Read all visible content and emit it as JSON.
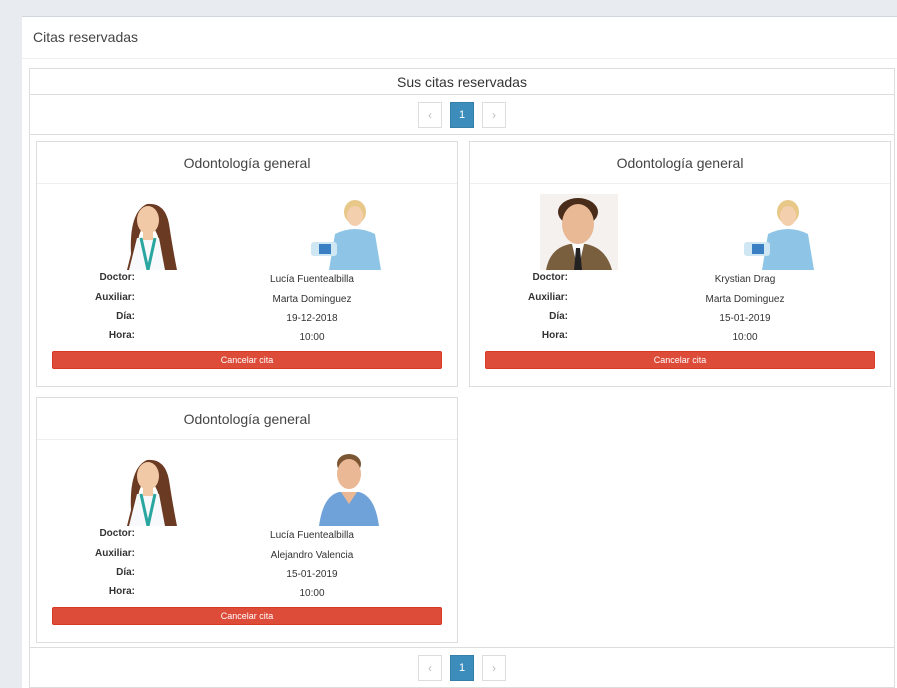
{
  "panel": {
    "title": "Citas reservadas"
  },
  "list": {
    "title": "Sus citas reservadas"
  },
  "pagination": {
    "prev": "‹",
    "page": "1",
    "next": "›"
  },
  "labels": {
    "doctor": "Doctor:",
    "auxiliar": "Auxiliar:",
    "dia": "Día:",
    "hora": "Hora:"
  },
  "appointments": [
    {
      "specialty": "Odontología general",
      "doctor": "Lucía Fuentealbilla",
      "auxiliar": "Marta Dominguez",
      "dia": "19-12-2018",
      "hora": "10:00",
      "cancel": "Cancelar cita"
    },
    {
      "specialty": "Odontología general",
      "doctor": "Krystian Drag",
      "auxiliar": "Marta Dominguez",
      "dia": "15-01-2019",
      "hora": "10:00",
      "cancel": "Cancelar cita"
    },
    {
      "specialty": "Odontología general",
      "doctor": "Lucía Fuentealbilla",
      "auxiliar": "Alejandro Valencia",
      "dia": "15-01-2019",
      "hora": "10:00",
      "cancel": "Cancelar cita"
    }
  ],
  "colors": {
    "accent": "#3c8dbc",
    "danger": "#dd4b39"
  }
}
